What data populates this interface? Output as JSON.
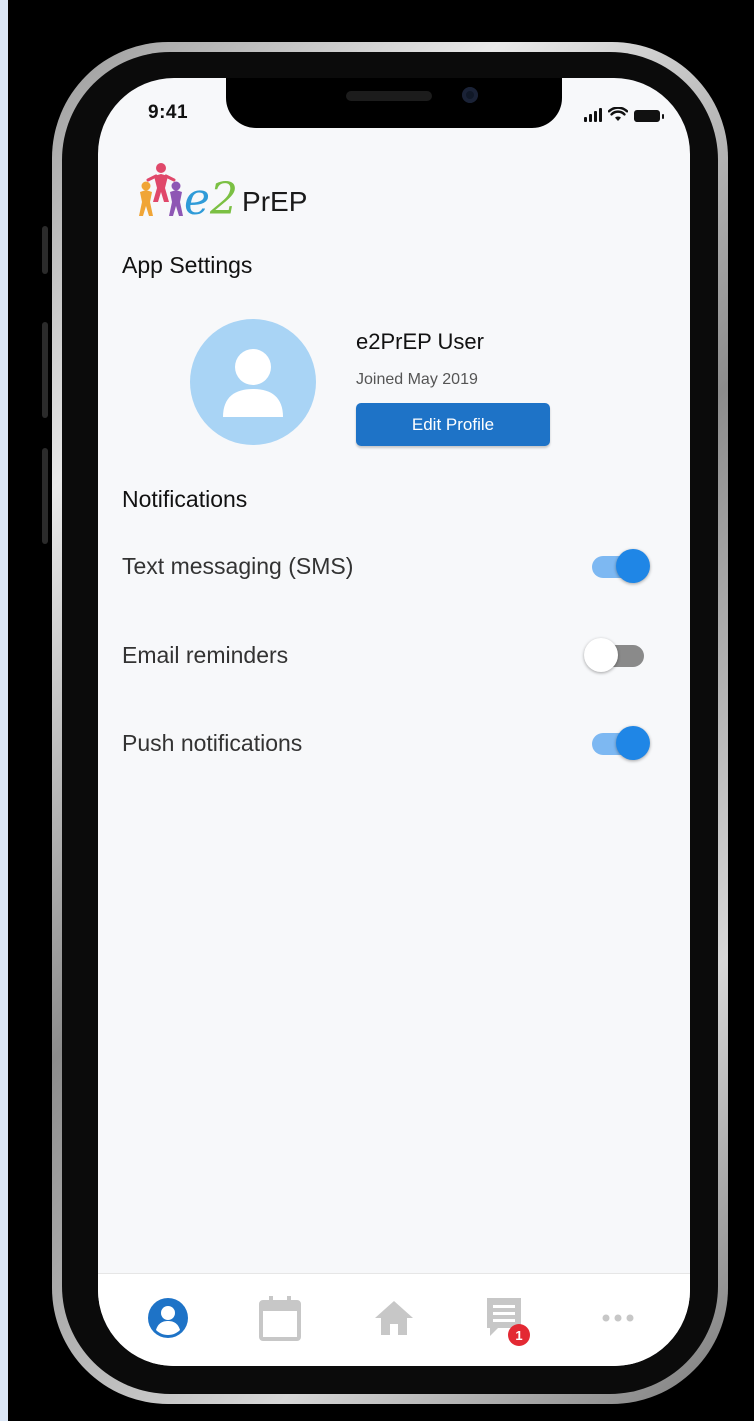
{
  "status_bar": {
    "time": "9:41"
  },
  "logo": {
    "e": "e",
    "two": "2",
    "prep": "PrEP"
  },
  "page": {
    "title": "App Settings"
  },
  "profile": {
    "name": "e2PrEP User",
    "joined": "Joined May 2019",
    "edit_label": "Edit Profile"
  },
  "notifications": {
    "title": "Notifications",
    "items": [
      {
        "label": "Text messaging (SMS)",
        "enabled": true
      },
      {
        "label": "Email reminders",
        "enabled": false
      },
      {
        "label": "Push notifications",
        "enabled": true
      }
    ]
  },
  "tabbar": {
    "tabs": [
      {
        "icon": "profile-icon",
        "active": true
      },
      {
        "icon": "calendar-icon",
        "active": false
      },
      {
        "icon": "home-icon",
        "active": false
      },
      {
        "icon": "messages-icon",
        "active": false,
        "badge": "1"
      },
      {
        "icon": "more-icon",
        "active": false
      }
    ]
  },
  "colors": {
    "accent": "#1e73c7",
    "toggle_on": "#1f86e6",
    "avatar_bg": "#a9d4f5",
    "badge": "#e32933",
    "tab_inactive": "#c7c7c7"
  }
}
